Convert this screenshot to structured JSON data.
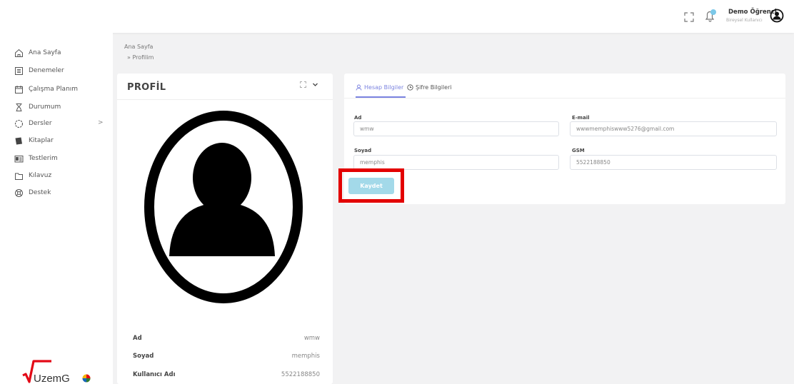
{
  "topbar": {
    "user_name": "Demo Öğrenci",
    "user_role": "Bireysel Kullanıcı",
    "icons": [
      "fullscreen-icon",
      "bell-icon",
      "user-avatar-icon"
    ]
  },
  "sidebar": {
    "items": [
      {
        "label": "Ana Sayfa",
        "icon": "home-icon"
      },
      {
        "label": "Denemeler",
        "icon": "document-icon"
      },
      {
        "label": "Çalışma Planım",
        "icon": "calendar-icon"
      },
      {
        "label": "Durumum",
        "icon": "hourglass-icon"
      },
      {
        "label": "Dersler",
        "icon": "circle-dashed-icon",
        "chevron": ">"
      },
      {
        "label": "Kitaplar",
        "icon": "book-icon"
      },
      {
        "label": "Testlerim",
        "icon": "id-card-icon"
      },
      {
        "label": "Kılavuz",
        "icon": "folder-icon"
      },
      {
        "label": "Destek",
        "icon": "support-icon"
      }
    ]
  },
  "logo": {
    "text": "UzemG"
  },
  "breadcrumb": {
    "home": "Ana Sayfa",
    "current": "» Profilim"
  },
  "profile_card": {
    "title": "PROFİL",
    "rows": [
      {
        "label": "Ad",
        "value": "wmw"
      },
      {
        "label": "Soyad",
        "value": "memphis"
      },
      {
        "label": "Kullanıcı Adı",
        "value": "5522188850"
      }
    ]
  },
  "form": {
    "tabs": [
      {
        "label": "Hesap Bilgiler",
        "icon": "user-icon",
        "active": true
      },
      {
        "label": "Şifre Bilgileri",
        "icon": "clock-icon",
        "active": false
      }
    ],
    "fields": {
      "ad": {
        "label": "Ad",
        "value": "wmw"
      },
      "email": {
        "label": "E-mail",
        "value": "wwwmemphiswww5276@gmail.com"
      },
      "soyad": {
        "label": "Soyad",
        "value": "memphis"
      },
      "gsm": {
        "label": "GSM",
        "value": "5522188850"
      }
    },
    "save_label": "Kaydet"
  },
  "colors": {
    "accent": "#7b83e0",
    "save_button": "#a3d9e9",
    "highlight": "#e30000"
  }
}
